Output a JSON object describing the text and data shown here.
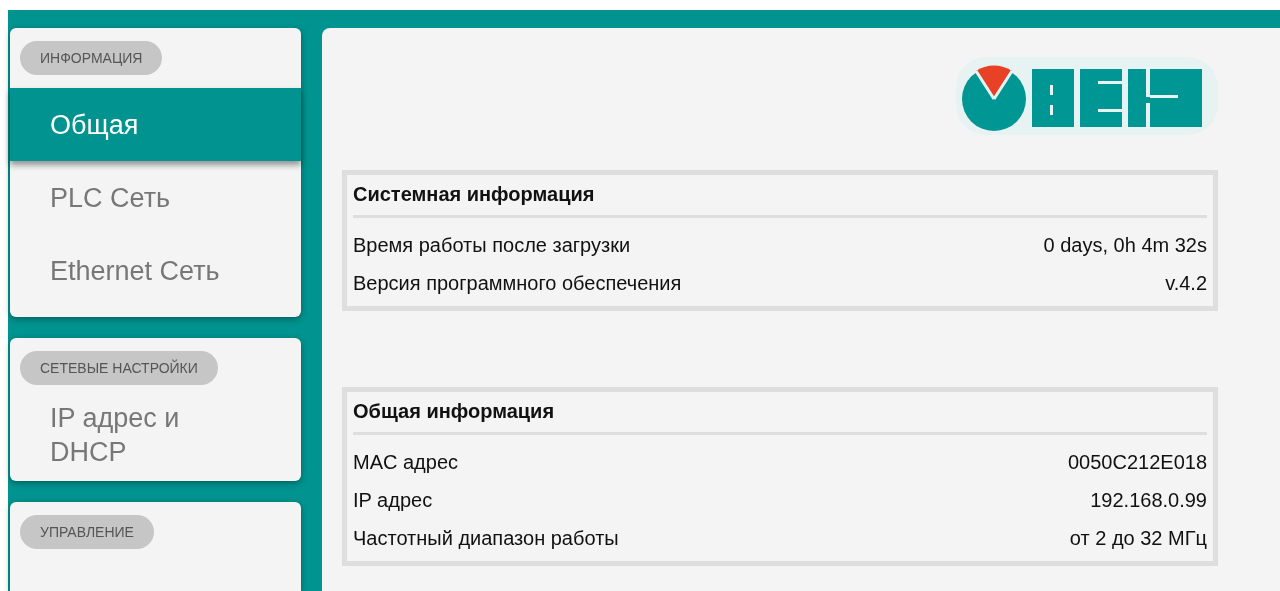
{
  "sidebar": {
    "sections": [
      {
        "title": "ИНФОРМАЦИЯ",
        "items": [
          {
            "label": "Общая",
            "selected": true
          },
          {
            "label": "PLC Сеть",
            "selected": false
          },
          {
            "label": "Ethernet Сеть",
            "selected": false
          }
        ]
      },
      {
        "title": "СЕТЕВЫЕ НАСТРОЙКИ",
        "items": [
          {
            "label": "IP адрес и DHCP",
            "selected": false
          }
        ]
      },
      {
        "title": "УПРАВЛЕНИЕ"
      }
    ]
  },
  "main": {
    "panels": [
      {
        "title": "Системная информация",
        "rows": [
          {
            "label": "Время работы после загрузки",
            "value": "0 days, 0h 4m 32s"
          },
          {
            "label": "Версия программного обеспечения",
            "value": "v.4.2"
          }
        ]
      },
      {
        "title": "Общая информация",
        "rows": [
          {
            "label": "MAC адрес",
            "value": "0050C212E018"
          },
          {
            "label": "IP адрес",
            "value": "192.168.0.99"
          },
          {
            "label": "Частотный диапазон работы",
            "value": "от 2 до 32 МГц"
          }
        ]
      }
    ]
  }
}
